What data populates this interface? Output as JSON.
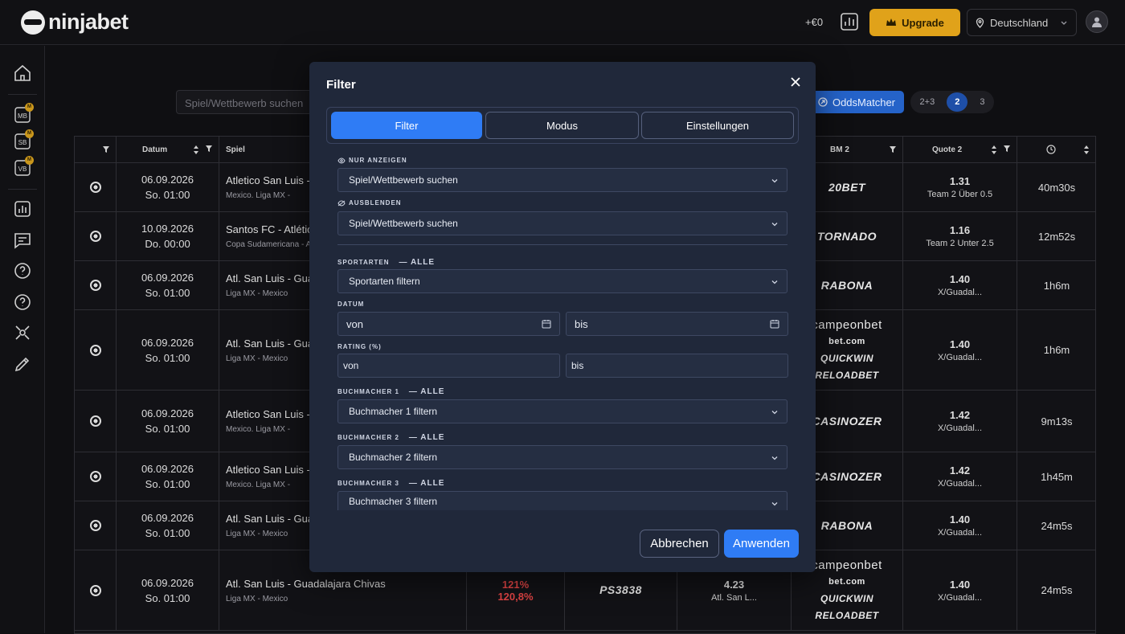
{
  "header": {
    "logo_text": "ninjabet",
    "balance": "+€0",
    "upgrade_label": "Upgrade",
    "country_label": "Deutschland"
  },
  "sidebar": {
    "items": [
      {
        "icon": "home-icon"
      },
      {
        "icon": "matched-betting-icon",
        "label": "MB"
      },
      {
        "icon": "sure-betting-icon",
        "label": "SB"
      },
      {
        "icon": "value-betting-icon",
        "label": "VB"
      },
      {
        "icon": "stats-icon"
      },
      {
        "icon": "chat-icon"
      },
      {
        "icon": "help-icon"
      },
      {
        "icon": "help-icon"
      },
      {
        "icon": "tools-icon"
      },
      {
        "icon": "edit-icon"
      }
    ],
    "badge_label": "M"
  },
  "toolbar": {
    "search_placeholder": "Spiel/Wettbewerb suchen",
    "oddsmatcher_label": "OddsMatcher",
    "segments": [
      "2+3",
      "2",
      "3"
    ]
  },
  "table": {
    "headers": {
      "datum": "Datum",
      "spiel": "Spiel",
      "bm2": "BM 2",
      "quote2": "Quote 2"
    },
    "rows": [
      {
        "date": "06.09.2026",
        "time": "So. 01:00",
        "match": "Atletico San Luis -",
        "league": "Mexico. Liga MX -",
        "bm2": [
          "20BET"
        ],
        "quote": "1.31",
        "quote_sub": "Team 2 Über 0.5",
        "remaining": "40m30s"
      },
      {
        "date": "10.09.2026",
        "time": "Do. 00:00",
        "match": "Santos FC - Atlétic",
        "league": "Copa Sudamericana - A",
        "bm2": [
          "TORNADO"
        ],
        "quote": "1.16",
        "quote_sub": "Team 2 Unter 2.5",
        "remaining": "12m52s"
      },
      {
        "date": "06.09.2026",
        "time": "So. 01:00",
        "match": "Atl. San Luis - Gua",
        "league": "Liga MX - Mexico",
        "bm2": [
          "RABONA"
        ],
        "quote": "1.40",
        "quote_sub": "X/Guadal...",
        "remaining": "1h6m"
      },
      {
        "date": "06.09.2026",
        "time": "So. 01:00",
        "match": "Atl. San Luis - Gua",
        "league": "Liga MX - Mexico",
        "bm2": [
          "campeonbet",
          "bet.com",
          "QUICKWIN",
          "RELOADBET"
        ],
        "quote": "1.40",
        "quote_sub": "X/Guadal...",
        "remaining": "1h6m"
      },
      {
        "date": "06.09.2026",
        "time": "So. 01:00",
        "match": "Atletico San Luis -",
        "league": "Mexico. Liga MX -",
        "bm2": [
          "CASINOZER"
        ],
        "quote": "1.42",
        "quote_sub": "X/Guadal...",
        "remaining": "9m13s"
      },
      {
        "date": "06.09.2026",
        "time": "So. 01:00",
        "match": "Atletico San Luis -",
        "league": "Mexico. Liga MX -",
        "bm2": [
          "CASINOZER"
        ],
        "quote": "1.42",
        "quote_sub": "X/Guadal...",
        "remaining": "1h45m"
      },
      {
        "date": "06.09.2026",
        "time": "So. 01:00",
        "match": "Atl. San Luis - Gua",
        "league": "Liga MX - Mexico",
        "bm2": [
          "RABONA"
        ],
        "quote": "1.40",
        "quote_sub": "X/Guadal...",
        "remaining": "24m5s"
      },
      {
        "date": "06.09.2026",
        "time": "So. 01:00",
        "match": "Atl. San Luis - Guadalajara Chivas",
        "league": "Liga MX - Mexico",
        "rating1": "121%",
        "rating2": "120,8%",
        "bm1": "PS3838",
        "quote1": "4.23",
        "quote1_sub": "Atl. San L...",
        "bm2": [
          "campeonbet",
          "bet.com",
          "QUICKWIN",
          "RELOADBET"
        ],
        "quote": "1.40",
        "quote_sub": "X/Guadal...",
        "remaining": "24m5s"
      }
    ]
  },
  "modal": {
    "title": "Filter",
    "tabs": [
      "Filter",
      "Modus",
      "Einstellungen"
    ],
    "only_show_label": "NUR ANZEIGEN",
    "only_show_placeholder": "Spiel/Wettbewerb suchen",
    "hide_label": "AUSBLENDEN",
    "hide_placeholder": "Spiel/Wettbewerb suchen",
    "sports_label": "SPORTARTEN",
    "all_label": "— ALLE",
    "sports_placeholder": "Sportarten filtern",
    "date_label": "DATUM",
    "date_from": "von",
    "date_to": "bis",
    "rating_label": "RATING (%)",
    "rating_from": "von",
    "rating_to": "bis",
    "bm1_label": "BUCHMACHER 1",
    "bm1_placeholder": "Buchmacher 1 filtern",
    "bm2_label": "BUCHMACHER 2",
    "bm2_placeholder": "Buchmacher 2 filtern",
    "bm3_label": "BUCHMACHER 3",
    "bm3_placeholder": "Buchmacher 3 filtern",
    "cancel_label": "Abbrechen",
    "apply_label": "Anwenden"
  },
  "colors": {
    "accent": "#2f7cf5",
    "upgrade": "#e0a21a",
    "rating_red": "#e04444"
  }
}
